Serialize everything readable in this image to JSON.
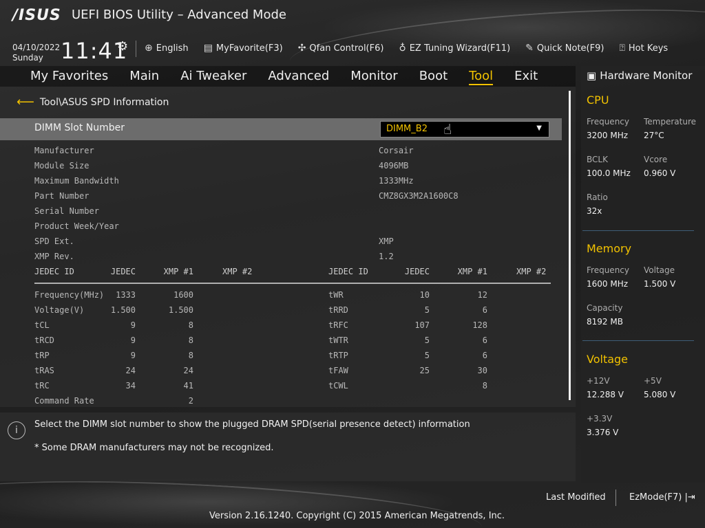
{
  "header": {
    "logo": "/ISUS",
    "title": "UEFI BIOS Utility – Advanced Mode",
    "date": "04/10/2022",
    "day": "Sunday",
    "time": "11:41"
  },
  "toolbar": [
    {
      "label": "English",
      "icon": "globe-icon"
    },
    {
      "label": "MyFavorite(F3)",
      "icon": "favorite-icon"
    },
    {
      "label": "Qfan Control(F6)",
      "icon": "fan-icon"
    },
    {
      "label": "EZ Tuning Wizard(F11)",
      "icon": "bulb-icon"
    },
    {
      "label": "Quick Note(F9)",
      "icon": "note-icon"
    },
    {
      "label": "Hot Keys",
      "icon": "question-icon"
    }
  ],
  "menu": [
    "My Favorites",
    "Main",
    "Ai Tweaker",
    "Advanced",
    "Monitor",
    "Boot",
    "Tool",
    "Exit"
  ],
  "menu_active": "Tool",
  "breadcrumb": "Tool\\ASUS SPD Information",
  "dimm": {
    "label": "DIMM Slot Number",
    "value": "DIMM_B2"
  },
  "spd_info": [
    {
      "key": "Manufacturer",
      "value": "Corsair"
    },
    {
      "key": "Module Size",
      "value": "4096MB"
    },
    {
      "key": "Maximum Bandwidth",
      "value": "1333MHz"
    },
    {
      "key": "Part Number",
      "value": "CMZ8GX3M2A1600C8"
    },
    {
      "key": "Serial Number",
      "value": ""
    },
    {
      "key": "Product Week/Year",
      "value": ""
    },
    {
      "key": "SPD Ext.",
      "value": "XMP"
    },
    {
      "key": "XMP Rev.",
      "value": "1.2"
    }
  ],
  "timing_headers": [
    "JEDEC ID",
    "JEDEC",
    "XMP #1",
    "XMP #2"
  ],
  "timings_left": [
    {
      "name": "Frequency(MHz)",
      "jedec": "1333",
      "xmp1": "1600",
      "xmp2": ""
    },
    {
      "name": "Voltage(V)",
      "jedec": "1.500",
      "xmp1": "1.500",
      "xmp2": ""
    },
    {
      "name": "tCL",
      "jedec": "9",
      "xmp1": "8",
      "xmp2": ""
    },
    {
      "name": "tRCD",
      "jedec": "9",
      "xmp1": "8",
      "xmp2": ""
    },
    {
      "name": "tRP",
      "jedec": "9",
      "xmp1": "8",
      "xmp2": ""
    },
    {
      "name": "tRAS",
      "jedec": "24",
      "xmp1": "24",
      "xmp2": ""
    },
    {
      "name": "tRC",
      "jedec": "34",
      "xmp1": "41",
      "xmp2": ""
    },
    {
      "name": "Command Rate",
      "jedec": "",
      "xmp1": "2",
      "xmp2": ""
    }
  ],
  "timings_right": [
    {
      "name": "tWR",
      "jedec": "10",
      "xmp1": "12",
      "xmp2": ""
    },
    {
      "name": "tRRD",
      "jedec": "5",
      "xmp1": "6",
      "xmp2": ""
    },
    {
      "name": "tRFC",
      "jedec": "107",
      "xmp1": "128",
      "xmp2": ""
    },
    {
      "name": "tWTR",
      "jedec": "5",
      "xmp1": "6",
      "xmp2": ""
    },
    {
      "name": "tRTP",
      "jedec": "5",
      "xmp1": "6",
      "xmp2": ""
    },
    {
      "name": "tFAW",
      "jedec": "25",
      "xmp1": "30",
      "xmp2": ""
    },
    {
      "name": "tCWL",
      "jedec": "",
      "xmp1": "8",
      "xmp2": ""
    }
  ],
  "help": {
    "line1": "Select the DIMM slot number to show the plugged DRAM SPD(serial presence detect) information",
    "line2": "* Some DRAM manufacturers may not be recognized."
  },
  "hw": {
    "title": "Hardware Monitor",
    "cpu": {
      "title": "CPU",
      "freq_k": "Frequency",
      "freq_v": "3200 MHz",
      "temp_k": "Temperature",
      "temp_v": "27°C",
      "bclk_k": "BCLK",
      "bclk_v": "100.0 MHz",
      "vcore_k": "Vcore",
      "vcore_v": "0.960 V",
      "ratio_k": "Ratio",
      "ratio_v": "32x"
    },
    "memory": {
      "title": "Memory",
      "freq_k": "Frequency",
      "freq_v": "1600 MHz",
      "volt_k": "Voltage",
      "volt_v": "1.500 V",
      "cap_k": "Capacity",
      "cap_v": "8192 MB"
    },
    "voltage": {
      "title": "Voltage",
      "v12_k": "+12V",
      "v12_v": "12.288 V",
      "v5_k": "+5V",
      "v5_v": "5.080 V",
      "v33_k": "+3.3V",
      "v33_v": "3.376 V"
    }
  },
  "footer": {
    "last_modified": "Last Modified",
    "ezmode": "EzMode(F7)",
    "version": "Version 2.16.1240. Copyright (C) 2015 American Megatrends, Inc."
  },
  "colors": {
    "accent": "#f2c200",
    "panel_line": "#3f5e78"
  }
}
